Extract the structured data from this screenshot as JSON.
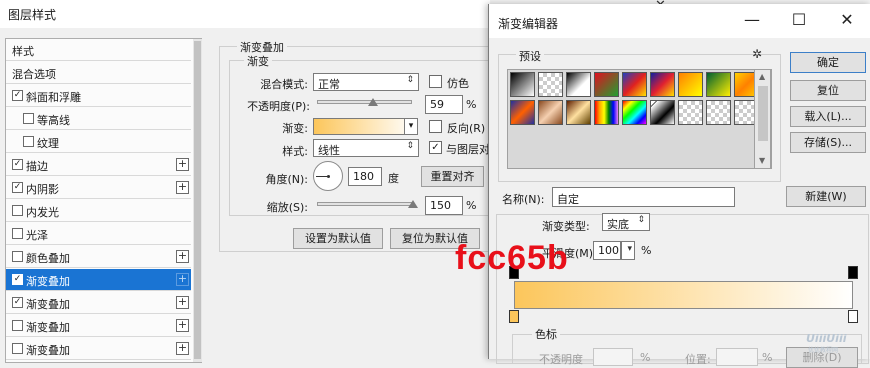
{
  "layer_style": {
    "title": "图层样式",
    "list": [
      {
        "label": "样式",
        "checkbox": false,
        "checked": false,
        "plus": false,
        "selected": false,
        "indent": false
      },
      {
        "label": "混合选项",
        "checkbox": false,
        "checked": false,
        "plus": false,
        "selected": false,
        "indent": false
      },
      {
        "label": "斜面和浮雕",
        "checkbox": true,
        "checked": true,
        "plus": false,
        "selected": false,
        "indent": false
      },
      {
        "label": "等高线",
        "checkbox": true,
        "checked": false,
        "plus": false,
        "selected": false,
        "indent": true
      },
      {
        "label": "纹理",
        "checkbox": true,
        "checked": false,
        "plus": false,
        "selected": false,
        "indent": true
      },
      {
        "label": "描边",
        "checkbox": true,
        "checked": true,
        "plus": true,
        "selected": false,
        "indent": false
      },
      {
        "label": "内阴影",
        "checkbox": true,
        "checked": true,
        "plus": true,
        "selected": false,
        "indent": false
      },
      {
        "label": "内发光",
        "checkbox": true,
        "checked": false,
        "plus": false,
        "selected": false,
        "indent": false
      },
      {
        "label": "光泽",
        "checkbox": true,
        "checked": false,
        "plus": false,
        "selected": false,
        "indent": false
      },
      {
        "label": "颜色叠加",
        "checkbox": true,
        "checked": false,
        "plus": true,
        "selected": false,
        "indent": false
      },
      {
        "label": "渐变叠加",
        "checkbox": true,
        "checked": true,
        "plus": true,
        "selected": true,
        "indent": false
      },
      {
        "label": "渐变叠加",
        "checkbox": true,
        "checked": true,
        "plus": true,
        "selected": false,
        "indent": false
      },
      {
        "label": "渐变叠加",
        "checkbox": true,
        "checked": false,
        "plus": true,
        "selected": false,
        "indent": false
      },
      {
        "label": "渐变叠加",
        "checkbox": true,
        "checked": false,
        "plus": true,
        "selected": false,
        "indent": false
      }
    ],
    "panel": {
      "group_title": "渐变叠加",
      "sub_group_title": "渐变",
      "blend_mode_label": "混合模式:",
      "blend_mode_value": "正常",
      "dither_label": "仿色",
      "opacity_label": "不透明度(P):",
      "opacity_value": "59",
      "opacity_unit": "%",
      "gradient_label": "渐变:",
      "reverse_label": "反向(R)",
      "style_label": "样式:",
      "style_value": "线性",
      "align_label": "与图层对",
      "angle_label": "角度(N):",
      "angle_value": "180",
      "angle_unit": "度",
      "reset_align_btn": "重置对齐",
      "scale_label": "缩放(S):",
      "scale_value": "150",
      "scale_unit": "%",
      "set_default_btn": "设置为默认值",
      "reset_default_btn": "复位为默认值",
      "opacity_fraction": 0.59,
      "scale_fraction": 0.99
    }
  },
  "gradient_editor": {
    "title": "渐变编辑器",
    "presets_label": "预设",
    "buttons": {
      "ok": "确定",
      "reset": "复位",
      "load": "载入(L)...",
      "save": "存储(S)...",
      "new": "新建(W)"
    },
    "name_label": "名称(N):",
    "name_value": "自定",
    "type_label": "渐变类型:",
    "type_value": "实底",
    "smoothness_label": "平滑度(M):",
    "smoothness_value": "100",
    "smoothness_unit": "%",
    "stops_label": "色标",
    "stop_opacity_label": "不透明度",
    "stop_opacity_unit": "%",
    "stop_location_label": "位置:",
    "stop_location_unit": "%",
    "delete_btn": "删除(D)",
    "gradient_start_color": "#fcc65b",
    "gradient_end_color": "#ffffff"
  },
  "overlay_text": "fcc65b",
  "watermark": "UiiiUiii",
  "watermark_sub": "优优教程网"
}
